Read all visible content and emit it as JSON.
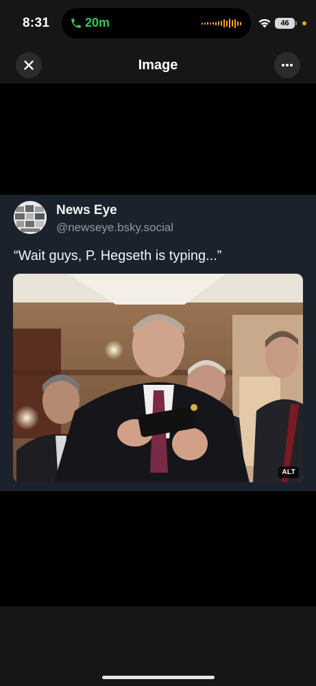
{
  "status_bar": {
    "time": "8:31",
    "call_duration": "20m",
    "battery": "46",
    "colors": {
      "call": "#34c759",
      "activity": "#f0a32a"
    }
  },
  "header": {
    "title": "Image",
    "close_icon": "close-icon",
    "more_icon": "more-horizontal-icon"
  },
  "post": {
    "author_name": "News Eye",
    "author_handle": "@newseye.bsky.social",
    "text": "“Wait guys, P. Hegseth is typing...”",
    "image_alt_badge": "ALT"
  },
  "colors": {
    "background": "#000000",
    "chrome": "#161616",
    "card": "#1c222c",
    "handle": "#8c99ab"
  }
}
